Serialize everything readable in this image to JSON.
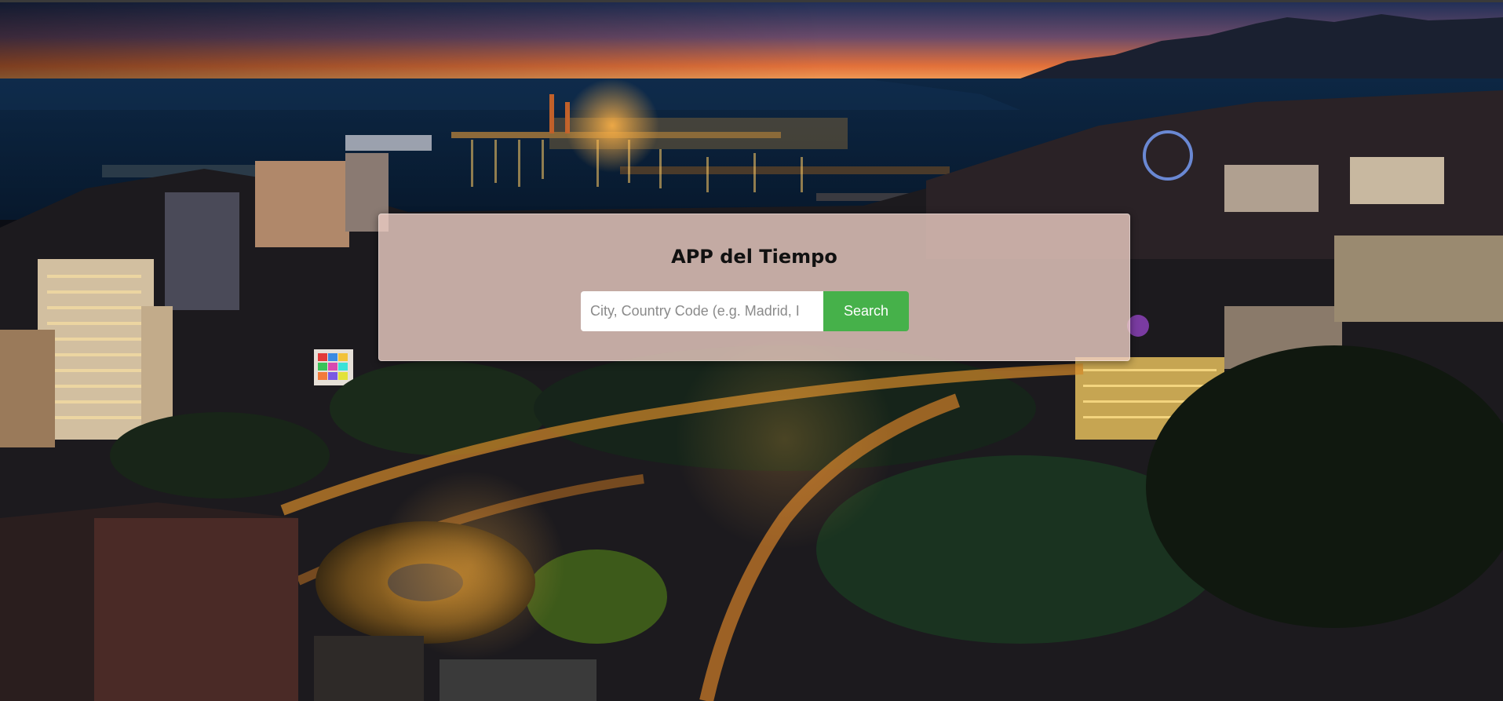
{
  "app": {
    "title": "APP del Tiempo"
  },
  "search": {
    "placeholder": "City, Country Code (e.g. Madrid, I",
    "value": "",
    "button_label": "Search"
  },
  "colors": {
    "button": "#46b14a",
    "card": "#eecec4",
    "sky_top": "#1c2e56",
    "sky_sunset": "#f07a2a"
  }
}
